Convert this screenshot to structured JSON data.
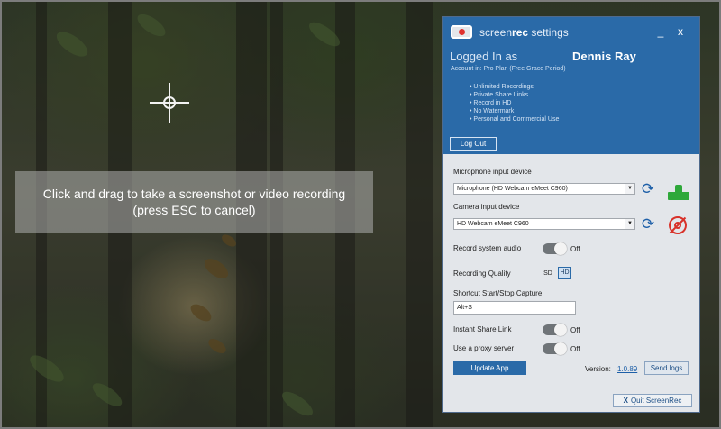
{
  "overlay": {
    "instruction_line1": "Click and drag to take a screenshot or video recording",
    "instruction_line2": "(press ESC to cancel)"
  },
  "window": {
    "title_light": "screen",
    "title_bold": "rec",
    "title_rest": " settings",
    "minimize_label": "_",
    "close_label": "x",
    "logged_in_label": "Logged In as",
    "user_name": "Dennis Ray",
    "account_plan": "Account in: Pro Plan (Free Grace Period)",
    "features": [
      "Unlimited Recordings",
      "Private Share Links",
      "Record in HD",
      "No Watermark",
      "Personal and Commercial Use"
    ],
    "logout_label": "Log Out"
  },
  "settings": {
    "mic_label": "Microphone input device",
    "mic_value": "Microphone (HD Webcam eMeet C960)",
    "camera_label": "Camera input device",
    "camera_value": "HD Webcam eMeet C960",
    "system_audio_label": "Record system audio",
    "system_audio_state": "Off",
    "quality_label": "Recording Quality",
    "quality_sd": "SD",
    "quality_hd": "HD",
    "shortcut_label": "Shortcut Start/Stop Capture",
    "shortcut_value": "Alt+S",
    "instant_share_label": "Instant Share Link",
    "instant_share_state": "Off",
    "proxy_label": "Use a proxy server",
    "proxy_state": "Off",
    "update_label": "Update App",
    "version_label": "Version:",
    "version_number": "1.0.89",
    "send_logs_label": "Send logs",
    "quit_label": "Quit ScreenRec"
  },
  "icons": {
    "app_logo": "screenrec-logo-icon",
    "refresh": "refresh-icon",
    "mic_status": "microphone-status-icon",
    "camera_status": "camera-disabled-icon"
  },
  "colors": {
    "accent": "#2a6aa8",
    "disabled_red": "#d8322a",
    "ok_green": "#2ea83a"
  }
}
